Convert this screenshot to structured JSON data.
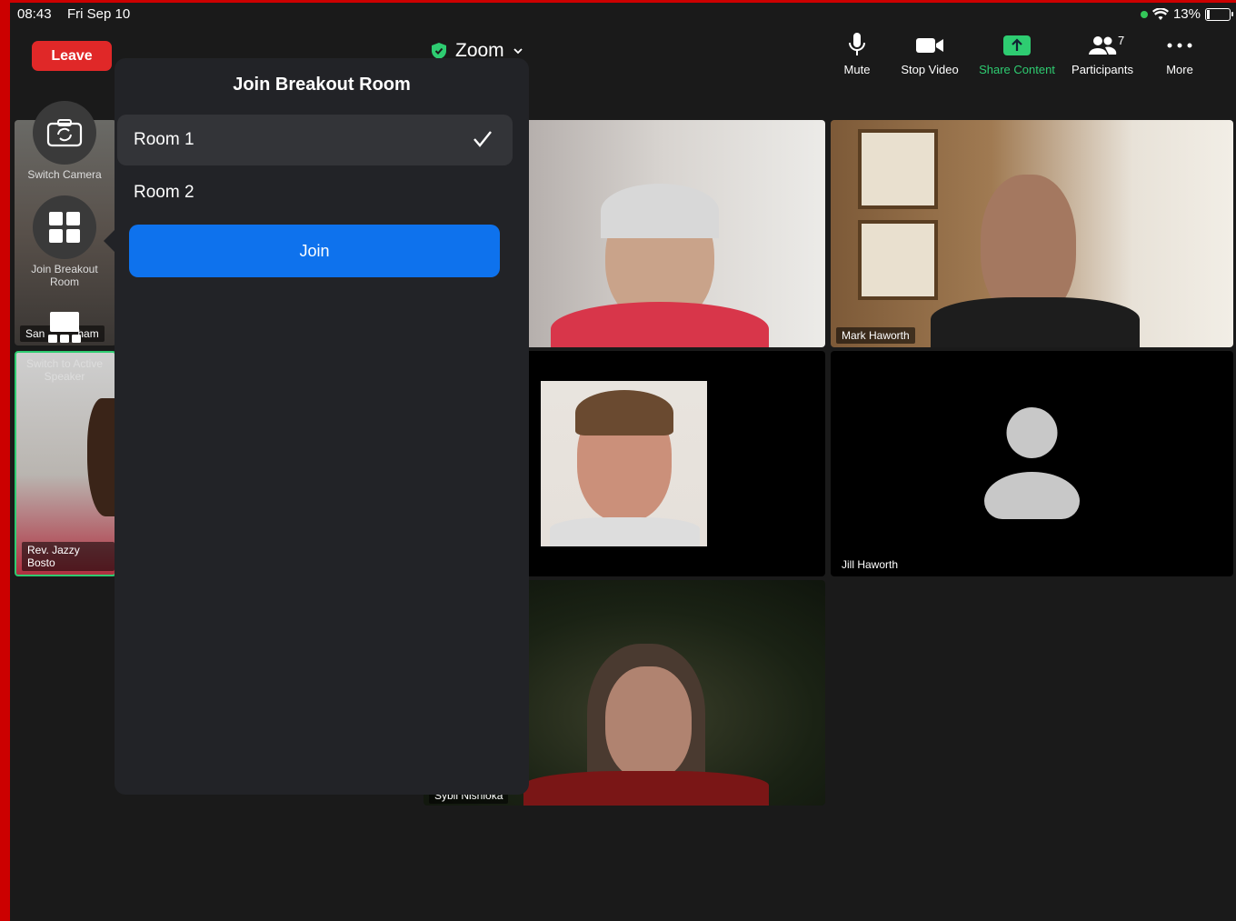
{
  "status": {
    "time": "08:43",
    "date": "Fri Sep 10",
    "battery": "13%"
  },
  "header": {
    "leave_label": "Leave",
    "title": "Zoom"
  },
  "toolbar": {
    "mute": "Mute",
    "stop_video": "Stop Video",
    "share_content": "Share Content",
    "participants": "Participants",
    "participants_count": "7",
    "more": "More"
  },
  "side_menu": {
    "switch_camera": "Switch Camera",
    "join_breakout": "Join Breakout Room",
    "switch_active": "Switch to Active Speaker"
  },
  "participants": {
    "mark": "Mark Haworth",
    "jill": "Jill Haworth",
    "jazzy": "Rev. Jazzy Bosto",
    "sybil_partial": "Sybil Nishioka",
    "san_partial": "San",
    "san_partial_end": "ham"
  },
  "breakout": {
    "title": "Join Breakout Room",
    "rooms": [
      "Room 1",
      "Room 2"
    ],
    "selected_index": 0,
    "join_label": "Join"
  },
  "colors": {
    "leave": "#e02828",
    "join": "#0e72ed",
    "share": "#2ecc71",
    "active_border": "#2ecc71"
  }
}
